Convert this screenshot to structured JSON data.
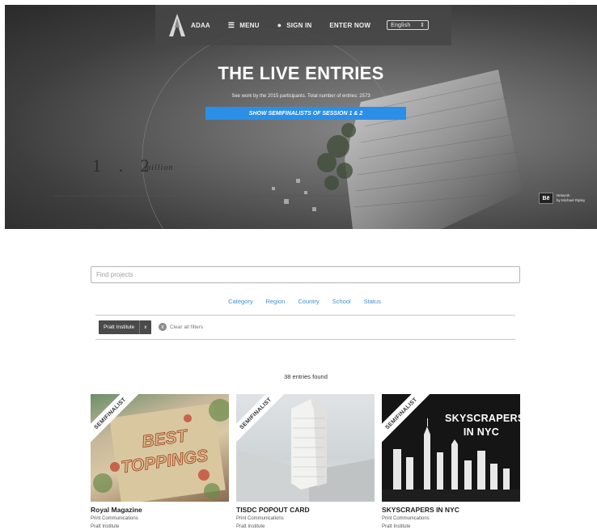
{
  "nav": {
    "brand": "ADAA",
    "menu_label": "MENU",
    "signin_label": "SIGN IN",
    "enter_label": "ENTER NOW",
    "language": "English"
  },
  "hero": {
    "title": "THE LIVE ENTRIES",
    "subtitle": "See work by the 2015 participants. Total number of entries: 2573",
    "button_label": "SHOW SEMIFINALISTS OF SESSION 1 & 2",
    "art_number": "1 . 2",
    "art_unit": "million",
    "credit_network": "Network",
    "credit_author": "by Michael Ripley",
    "behance_badge": "Bē"
  },
  "filters": {
    "search_placeholder": "Find projects",
    "links": [
      "Category",
      "Region",
      "Country",
      "School",
      "Status"
    ],
    "active_chip": "Pratt Institute",
    "chip_remove": "x",
    "clear_label": "Clear all filters",
    "clear_icon": "x"
  },
  "results": {
    "count_text": "38 entries found",
    "ribbon_label": "SEMIFINALIST",
    "cards": [
      {
        "title": "Royal Magazine",
        "category": "Print Communications",
        "school": "Pratt Institute",
        "art_text": "BEST TOPPINGS"
      },
      {
        "title": "TISDC POPOUT CARD",
        "category": "Print Communications",
        "school": "Pratt Institute"
      },
      {
        "title": "SKYSCRAPERS IN NYC",
        "category": "Print Communications",
        "school": "Pratt Institute",
        "art_text_1": "SKYSCRAPERS",
        "art_text_2": "IN NYC"
      }
    ]
  },
  "colors": {
    "accent_blue": "#2b8fe8",
    "link_blue": "#3f8fd0",
    "chip_bg": "#4a4a4a"
  }
}
